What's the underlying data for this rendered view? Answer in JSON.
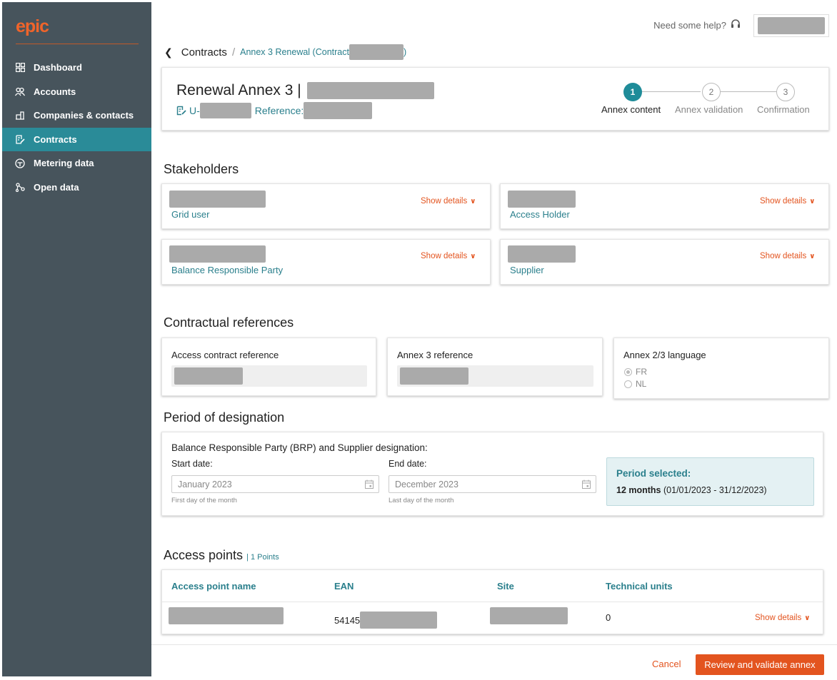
{
  "app": {
    "logo": "epic"
  },
  "sidebar": {
    "items": [
      {
        "label": "Dashboard",
        "icon": "grid-icon"
      },
      {
        "label": "Accounts",
        "icon": "users-icon"
      },
      {
        "label": "Companies & contacts",
        "icon": "building-icon"
      },
      {
        "label": "Contracts",
        "icon": "contract-icon"
      },
      {
        "label": "Metering data",
        "icon": "gauge-icon"
      },
      {
        "label": "Open data",
        "icon": "network-icon"
      }
    ],
    "active": "Contracts"
  },
  "header": {
    "help_text": "Need some help?"
  },
  "breadcrumb": {
    "root": "Contracts",
    "separator": "/",
    "current": "Annex 3 Renewal (Contract",
    "current_end": ")"
  },
  "annex": {
    "title": "Renewal Annex 3 |",
    "id_prefix": "U-",
    "reference_label": "Reference:"
  },
  "stepper": {
    "steps": [
      {
        "number": "1",
        "label": "Annex content",
        "state": "active"
      },
      {
        "number": "2",
        "label": "Annex validation",
        "state": "inactive"
      },
      {
        "number": "3",
        "label": "Confirmation",
        "state": "inactive"
      }
    ]
  },
  "stakeholders": {
    "title": "Stakeholders",
    "show_details": "Show details",
    "cards": [
      {
        "role": "Grid user"
      },
      {
        "role": "Access Holder"
      },
      {
        "role": "Balance Responsible Party"
      },
      {
        "role": "Supplier"
      }
    ]
  },
  "contractual": {
    "title": "Contractual references",
    "access_contract_label": "Access contract reference",
    "annex3_label": "Annex 3 reference",
    "language_label": "Annex 2/3 language",
    "languages": [
      "FR",
      "NL"
    ],
    "selected_language": "FR"
  },
  "period": {
    "title": "Period of designation",
    "heading": "Balance Responsible Party (BRP) and Supplier designation:",
    "start_label": "Start date:",
    "start_value": "January 2023",
    "start_hint": "First day of the month",
    "end_label": "End date:",
    "end_value": "December 2023",
    "end_hint": "Last day of the month",
    "selected_title": "Period selected:",
    "selected_months": "12 months",
    "selected_range": "(01/01/2023 - 31/12/2023)"
  },
  "access_points": {
    "title": "Access points",
    "count_label": "| 1 Points",
    "columns": [
      "Access point name",
      "EAN",
      "Site",
      "Technical units"
    ],
    "rows": [
      {
        "ean_prefix": "54145",
        "technical_units": "0"
      }
    ],
    "show_details": "Show details"
  },
  "actions": {
    "cancel": "Cancel",
    "primary": "Review and validate annex"
  },
  "colors": {
    "sidebar": "#47545c",
    "active_nav": "#2a8b98",
    "accent": "#e3541f",
    "teal_text": "#2a7f8c"
  }
}
